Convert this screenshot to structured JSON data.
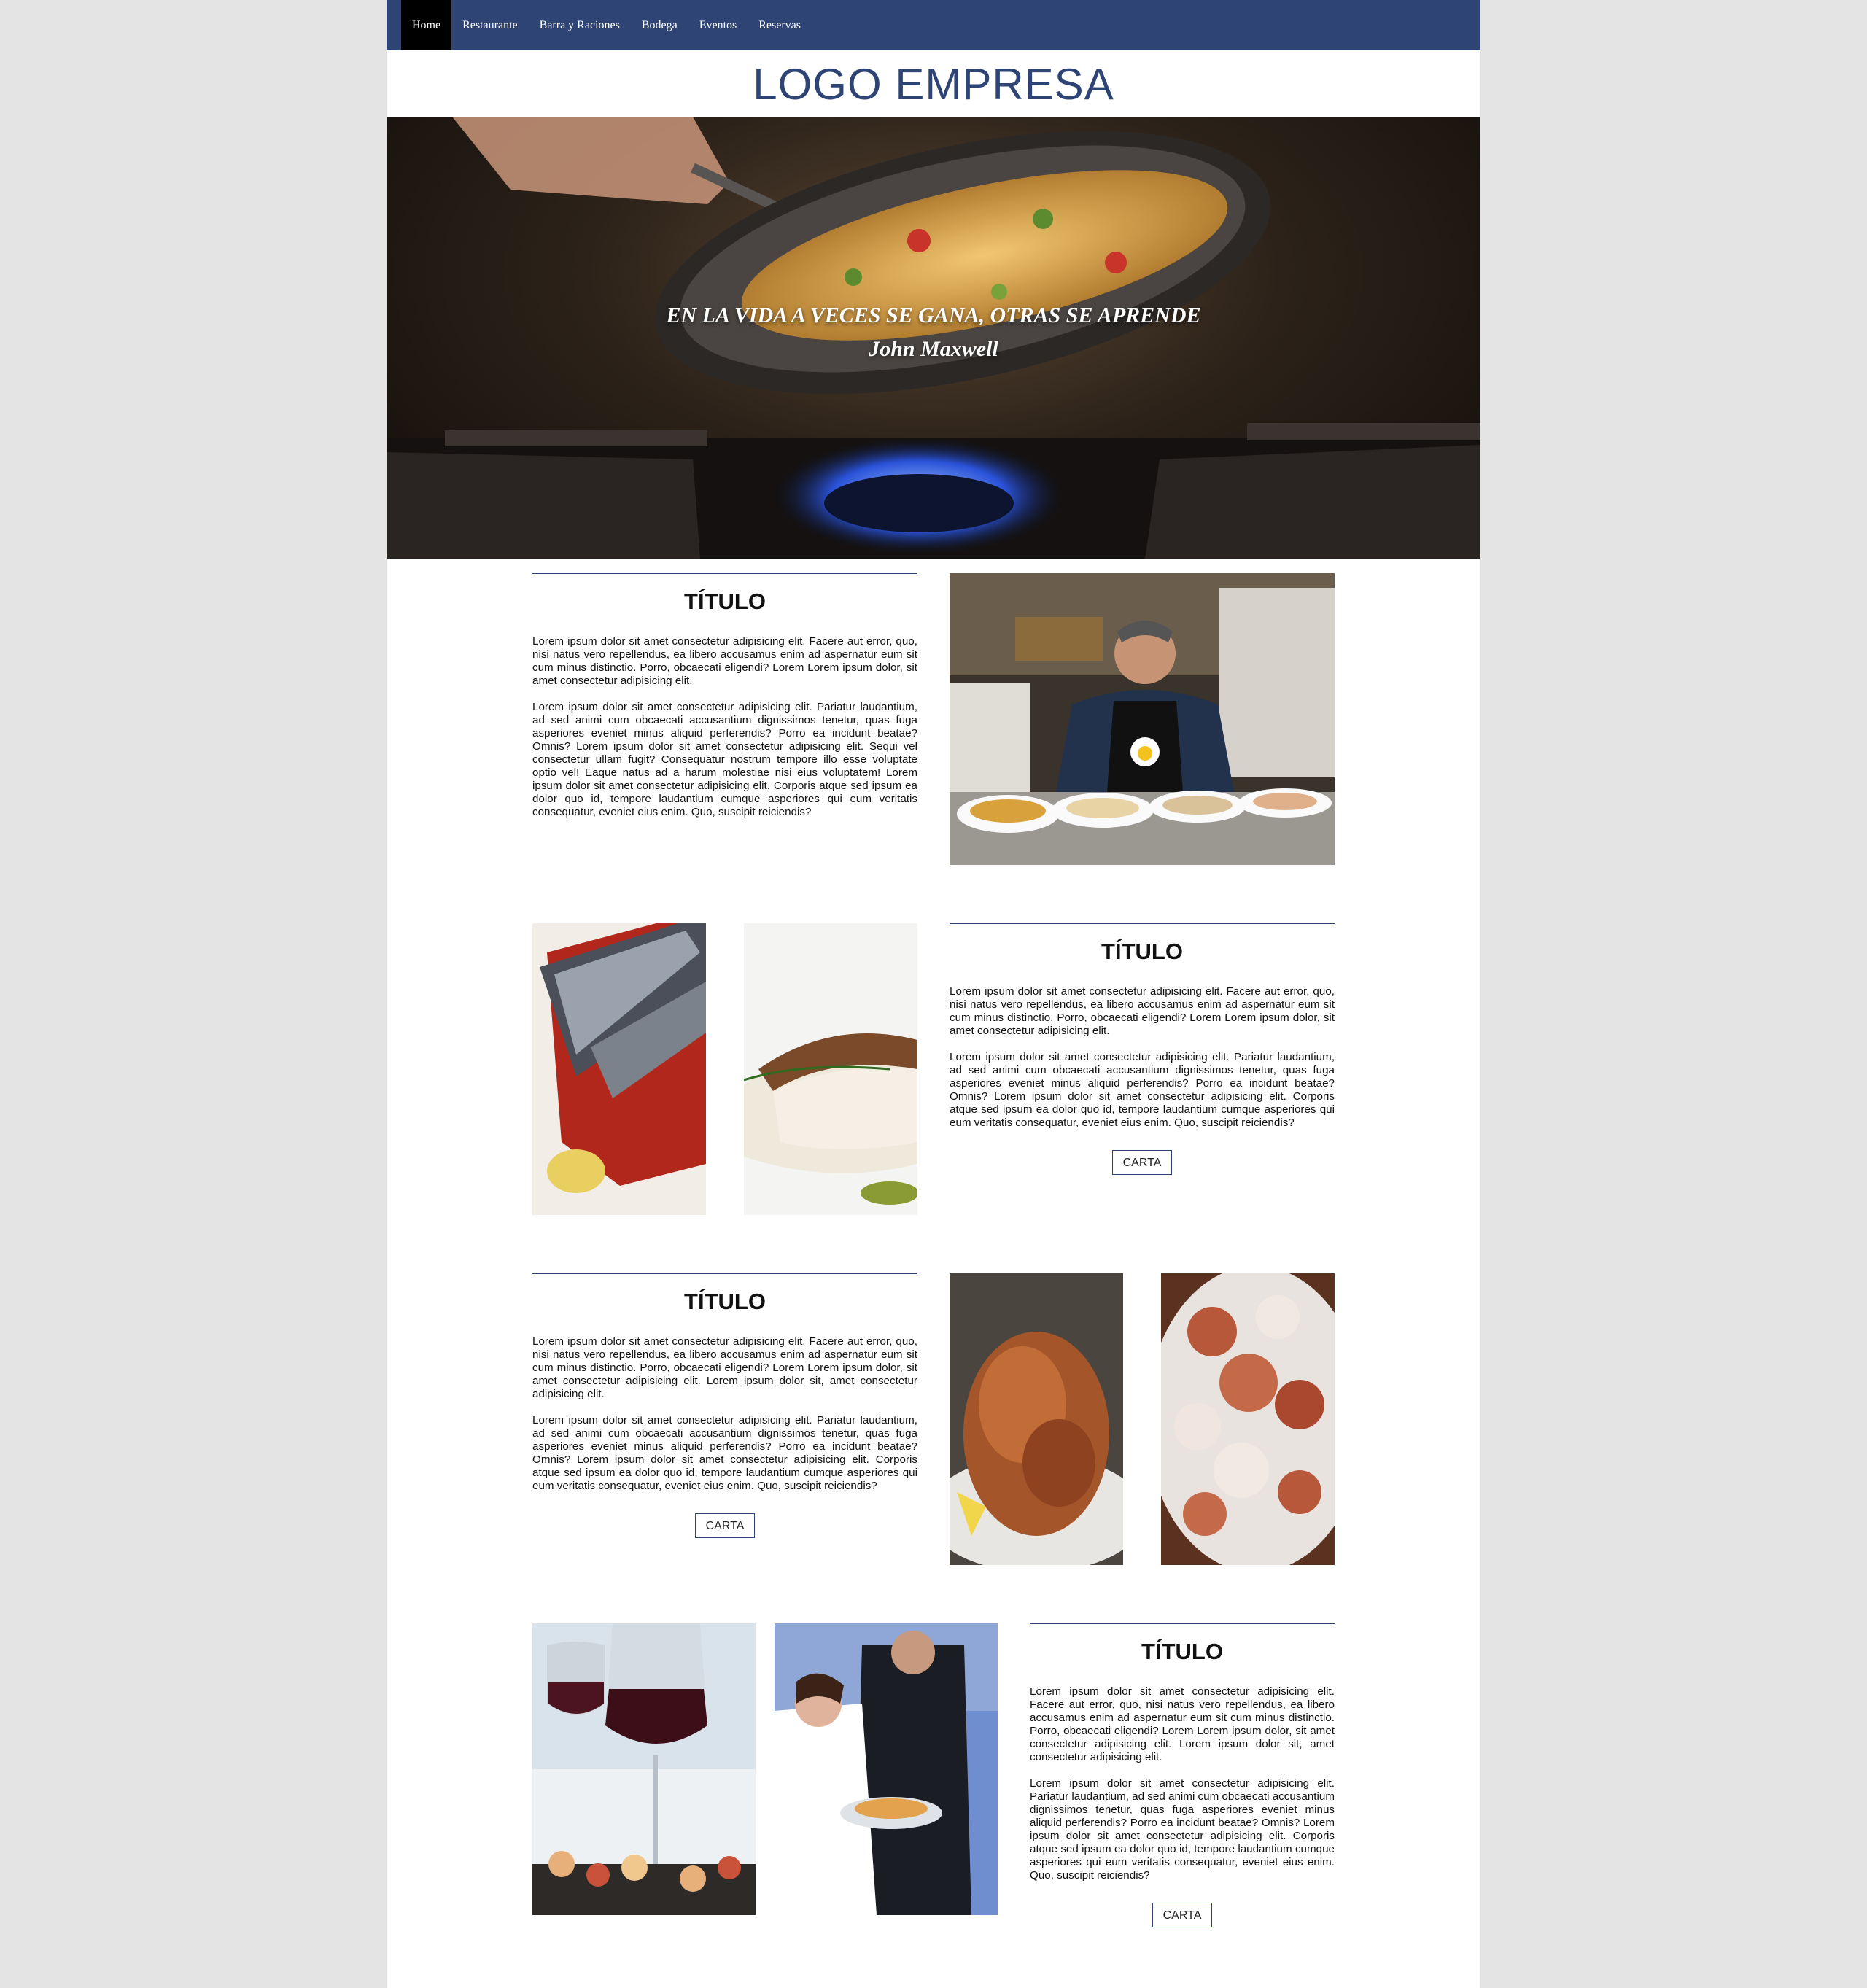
{
  "nav": {
    "items": [
      {
        "label": "Home",
        "active": true
      },
      {
        "label": "Restaurante",
        "active": false
      },
      {
        "label": "Barra y Raciones",
        "active": false
      },
      {
        "label": "Bodega",
        "active": false
      },
      {
        "label": "Eventos",
        "active": false
      },
      {
        "label": "Reservas",
        "active": false
      }
    ]
  },
  "logo": "LOGO EMPRESA",
  "hero": {
    "quote": "EN LA VIDA A VECES SE GANA, OTRAS SE APRENDE",
    "author": "John Maxwell"
  },
  "sections": [
    {
      "title": "TÍTULO",
      "p1": "Lorem ipsum dolor sit amet consectetur adipisicing elit. Facere aut error, quo, nisi natus vero repellendus, ea libero accusamus enim ad aspernatur eum sit cum minus distinctio. Porro, obcaecati eligendi? Lorem Lorem ipsum dolor, sit amet consectetur adipisicing elit.",
      "p2": "Lorem ipsum dolor sit amet consectetur adipisicing elit. Pariatur laudantium, ad sed animi cum obcaecati accusantium dignissimos tenetur, quas fuga asperiores eveniet minus aliquid perferendis? Porro ea incidunt beatae? Omnis? Lorem ipsum dolor sit amet consectetur adipisicing elit. Sequi vel consectetur ullam fugit? Consequatur nostrum tempore illo esse voluptate optio vel! Eaque natus ad a harum molestiae nisi eius voluptatem! Lorem ipsum dolor sit amet consectetur adipisicing elit. Corporis atque sed ipsum ea dolor quo id, tempore laudantium cumque asperiores qui eum veritatis consequatur, eveniet eius enim. Quo, suscipit reiciendis?"
    },
    {
      "title": "TÍTULO",
      "p1": "Lorem ipsum dolor sit amet consectetur adipisicing elit. Facere aut error, quo, nisi natus vero repellendus, ea libero accusamus enim ad aspernatur eum sit cum minus distinctio. Porro, obcaecati eligendi? Lorem Lorem ipsum dolor, sit amet consectetur adipisicing elit.",
      "p2": "Lorem ipsum dolor sit amet consectetur adipisicing elit. Pariatur laudantium, ad sed animi cum obcaecati accusantium dignissimos tenetur, quas fuga asperiores eveniet minus aliquid perferendis? Porro ea incidunt beatae? Omnis? Lorem ipsum dolor sit amet consectetur adipisicing elit. Corporis atque sed ipsum ea dolor quo id, tempore laudantium cumque asperiores qui eum veritatis consequatur, eveniet eius enim. Quo, suscipit reiciendis?",
      "button": "CARTA"
    },
    {
      "title": "TÍTULO",
      "p1": "Lorem ipsum dolor sit amet consectetur adipisicing elit. Facere aut error, quo, nisi natus vero repellendus, ea libero accusamus enim ad aspernatur eum sit cum minus distinctio. Porro, obcaecati eligendi? Lorem Lorem ipsum dolor, sit amet consectetur adipisicing elit. Lorem ipsum dolor sit, amet consectetur adipisicing elit.",
      "p2": "Lorem ipsum dolor sit amet consectetur adipisicing elit. Pariatur laudantium, ad sed animi cum obcaecati accusantium dignissimos tenetur, quas fuga asperiores eveniet minus aliquid perferendis? Porro ea incidunt beatae? Omnis? Lorem ipsum dolor sit amet consectetur adipisicing elit. Corporis atque sed ipsum ea dolor quo id, tempore laudantium cumque asperiores qui eum veritatis consequatur, eveniet eius enim. Quo, suscipit reiciendis?",
      "button": "CARTA"
    },
    {
      "title": "TÍTULO",
      "p1": "Lorem ipsum dolor sit amet consectetur adipisicing elit. Facere aut error, quo, nisi natus vero repellendus, ea libero accusamus enim ad aspernatur eum sit cum minus distinctio. Porro, obcaecati eligendi? Lorem Lorem ipsum dolor, sit amet consectetur adipisicing elit. Lorem ipsum dolor sit, amet consectetur adipisicing elit.",
      "p2": "Lorem ipsum dolor sit amet consectetur adipisicing elit. Pariatur laudantium, ad sed animi cum obcaecati accusantium dignissimos tenetur, quas fuga asperiores eveniet minus aliquid perferendis? Porro ea incidunt beatae? Omnis? Lorem ipsum dolor sit amet consectetur adipisicing elit. Corporis atque sed ipsum ea dolor quo id, tempore laudantium cumque asperiores qui eum veritatis consequatur, eveniet eius enim. Quo, suscipit reiciendis?",
      "button": "CARTA"
    }
  ],
  "colors": {
    "nav_bg": "#2d4475",
    "nav_active": "#000000",
    "logo": "#2d4475",
    "page_bg": "#e4e4e4"
  }
}
